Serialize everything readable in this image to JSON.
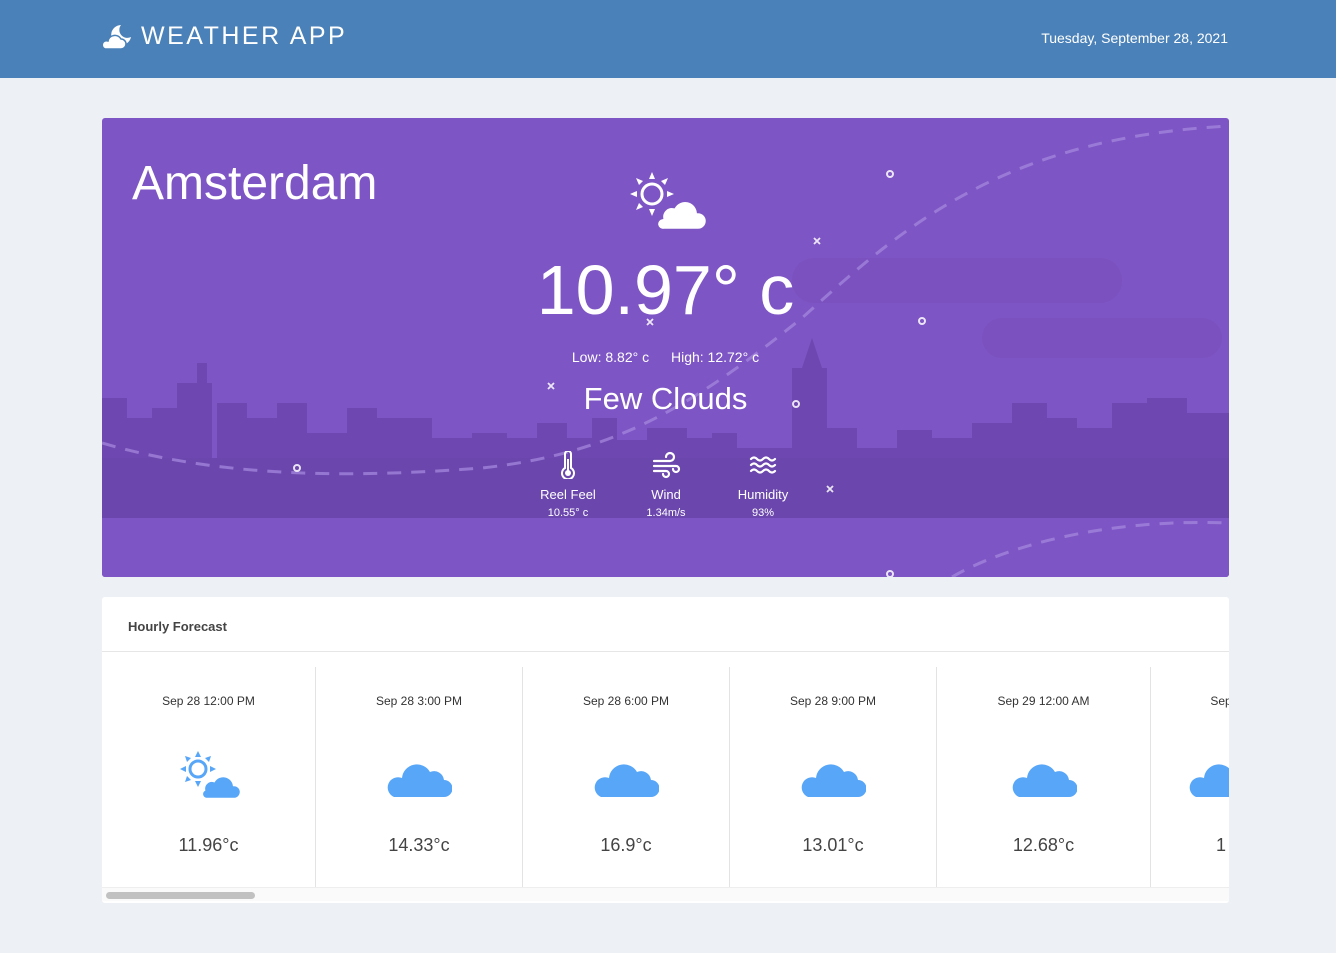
{
  "header": {
    "app_title": "WEATHER APP",
    "date": "Tuesday, September 28, 2021",
    "logo_icon": "moon-cloud-icon"
  },
  "current": {
    "city": "Amsterdam",
    "condition_icon": "sun-cloud-icon",
    "temperature": "10.97° c",
    "low": "Low: 8.82° c",
    "high": "High: 12.72° c",
    "description": "Few Clouds",
    "stats": [
      {
        "icon": "thermometer-icon",
        "label": "Reel Feel",
        "value": "10.55° c"
      },
      {
        "icon": "wind-icon",
        "label": "Wind",
        "value": "1.34m/s"
      },
      {
        "icon": "humidity-icon",
        "label": "Humidity",
        "value": "93%"
      }
    ]
  },
  "forecast": {
    "title": "Hourly Forecast",
    "items": [
      {
        "time": "Sep 28 12:00 PM",
        "icon": "sun-cloud-icon",
        "temp": "11.96°c"
      },
      {
        "time": "Sep 28 3:00 PM",
        "icon": "cloud-icon",
        "temp": "14.33°c"
      },
      {
        "time": "Sep 28 6:00 PM",
        "icon": "cloud-icon",
        "temp": "16.9°c"
      },
      {
        "time": "Sep 28 9:00 PM",
        "icon": "cloud-icon",
        "temp": "13.01°c"
      },
      {
        "time": "Sep 29 12:00 AM",
        "icon": "cloud-icon",
        "temp": "12.68°c"
      },
      {
        "time": "Sep",
        "icon": "cloud-icon",
        "temp": "1"
      }
    ]
  },
  "colors": {
    "header": "#4a81b8",
    "hero": "#7e55c4",
    "forecast_icon": "#57a6f8",
    "background": "#edf1f6"
  }
}
